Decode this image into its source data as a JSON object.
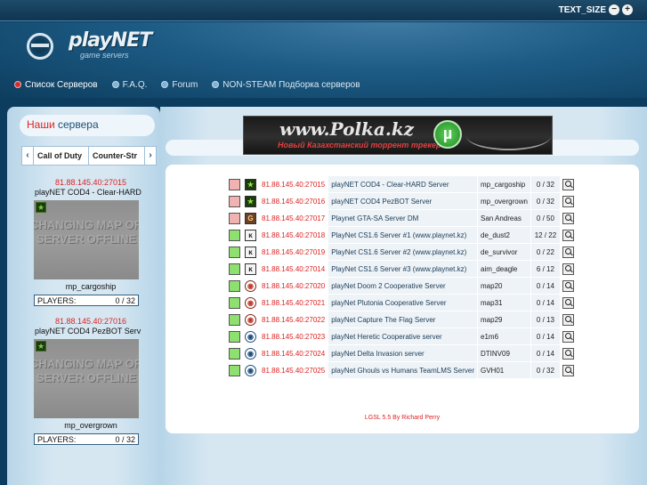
{
  "topbar": {
    "text_size_label": "TEXT_SIZE",
    "decrease": "−",
    "increase": "+"
  },
  "logo": {
    "text": "playNET",
    "sub": "game servers"
  },
  "nav": [
    {
      "label": "Список Серверов",
      "active": true
    },
    {
      "label": "F.A.Q.",
      "active": false
    },
    {
      "label": "Forum",
      "active": false
    },
    {
      "label": "NON-STEAM Подборка серверов",
      "active": false
    }
  ],
  "sidebar": {
    "title_first": "Наши",
    "title_rest": " сервера",
    "tabs": [
      "Call of Duty",
      "Counter-Str"
    ],
    "prev": "‹",
    "next": "›",
    "servers": [
      {
        "ip": "81.88.145.40:27015",
        "name": "playNET COD4 - Clear-HARD",
        "image_text": "CHANGING MAP OR SERVER OFFLINE",
        "map": "mp_cargoship",
        "players_label": "PLAYERS:",
        "players": "0 / 32"
      },
      {
        "ip": "81.88.145.40:27016",
        "name": "playNET COD4 PezBOT Serv",
        "image_text": "CHANGING MAP OR SERVER OFFLINE",
        "map": "mp_overgrown",
        "players_label": "PLAYERS:",
        "players": "0 / 32"
      }
    ]
  },
  "banner": {
    "title": "www.Polka.kz",
    "subtitle": "Новый Казахстанский торрент трекер"
  },
  "servers": [
    {
      "status": "off",
      "game": "cod",
      "ip": "81.88.145.40:27015",
      "name": "playNET COD4 - Clear-HARD Server",
      "map": "mp_cargoship",
      "players": "0 / 32"
    },
    {
      "status": "off",
      "game": "cod",
      "ip": "81.88.145.40:27016",
      "name": "playNET COD4 PezBOT Server",
      "map": "mp_overgrown",
      "players": "0 / 32"
    },
    {
      "status": "off",
      "game": "gta",
      "ip": "81.88.145.40:27017",
      "name": "Playnet GTA-SA Server DM",
      "map": "San Andreas",
      "players": "0 / 50"
    },
    {
      "status": "on",
      "game": "cs",
      "ip": "81.88.145.40:27018",
      "name": "PlayNet CS1.6 Server #1 (www.playnet.kz)",
      "map": "de_dust2",
      "players": "12 / 22"
    },
    {
      "status": "on",
      "game": "cs",
      "ip": "81.88.145.40:27019",
      "name": "PlayNet CS1.6 Server #2 (www.playnet.kz)",
      "map": "de_survivor",
      "players": "0 / 22"
    },
    {
      "status": "on",
      "game": "cs",
      "ip": "81.88.145.40:27014",
      "name": "PlayNet CS1.6 Server #3 (www.playnet.kz)",
      "map": "aim_deagle",
      "players": "6 / 12"
    },
    {
      "status": "on",
      "game": "doom",
      "ip": "81.88.145.40:27020",
      "name": "playNet Doom 2 Cooperative Server",
      "map": "map20",
      "players": "0 / 14"
    },
    {
      "status": "on",
      "game": "doom",
      "ip": "81.88.145.40:27021",
      "name": "playNet Plutonia Cooperative Server",
      "map": "map31",
      "players": "0 / 14"
    },
    {
      "status": "on",
      "game": "doom",
      "ip": "81.88.145.40:27022",
      "name": "playNet Capture The Flag Server",
      "map": "map29",
      "players": "0 / 13"
    },
    {
      "status": "on",
      "game": "heretic",
      "ip": "81.88.145.40:27023",
      "name": "playNet Heretic Cooperative server",
      "map": "e1m6",
      "players": "0 / 14"
    },
    {
      "status": "on",
      "game": "heretic",
      "ip": "81.88.145.40:27024",
      "name": "playNet Delta Invasion server",
      "map": "DTINV09",
      "players": "0 / 14"
    },
    {
      "status": "on",
      "game": "heretic",
      "ip": "81.88.145.40:27025",
      "name": "playNet Ghouls vs Humans TeamLMS Server",
      "map": "GVH01",
      "players": "0 / 32"
    }
  ],
  "game_icons": {
    "cod": "★",
    "gta": "G",
    "cs": "ᴋ",
    "doom": "◉",
    "heretic": "◉"
  },
  "footer": "LGSL 5.5 By Richard Perry"
}
